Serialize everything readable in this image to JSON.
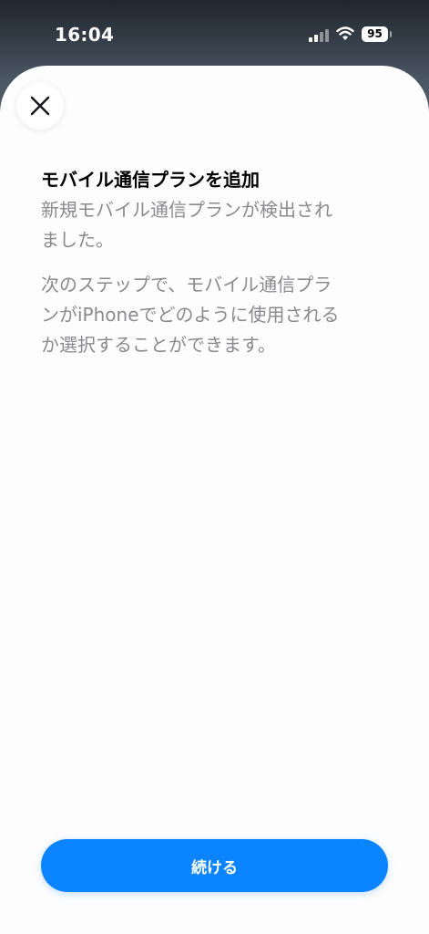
{
  "status_bar": {
    "time": "16:04",
    "battery": "95"
  },
  "sheet": {
    "title": "モバイル通信プランを追加",
    "subtitle_lines": [
      "新規モバイル通信プランが検出され",
      "ました。"
    ],
    "description_lines": [
      "次のステップで、モバイル通信プラ",
      "ンがiPhoneでどのように使用される",
      "か選択することができます。"
    ],
    "continue_label": "続ける"
  },
  "colors": {
    "accent": "#0a84ff",
    "secondary_text": "#8a8a8e",
    "sheet_background": "#fdfdfd"
  }
}
